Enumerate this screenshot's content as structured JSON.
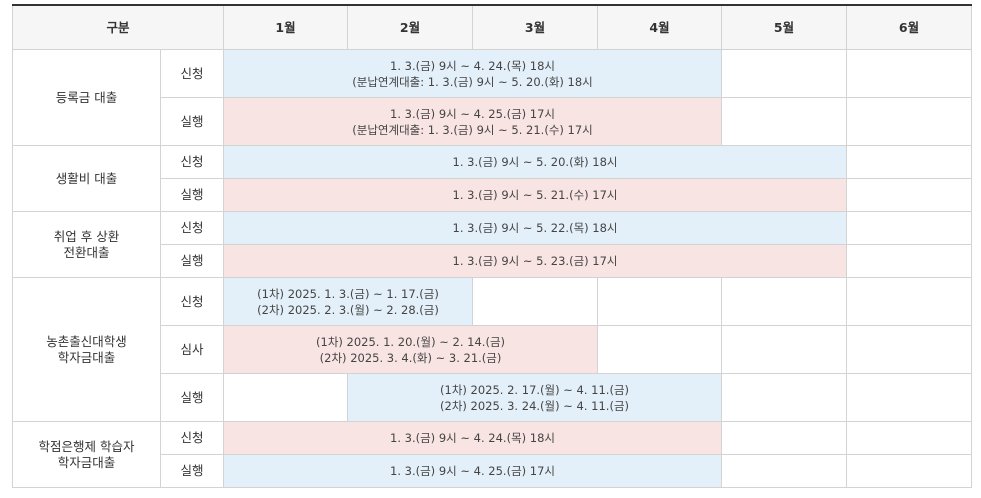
{
  "header": {
    "category": "구분",
    "months": [
      "1월",
      "2월",
      "3월",
      "4월",
      "5월",
      "6월"
    ]
  },
  "groups": [
    {
      "name": [
        "등록금 대출"
      ],
      "rows": [
        {
          "label": "신청",
          "lead": 0,
          "span": 4,
          "color": "blue",
          "lines": [
            "1. 3.(금) 9시 ~ 4. 24.(목) 18시",
            "(분납연계대출: 1. 3.(금) 9시 ~ 5. 20.(화) 18시"
          ]
        },
        {
          "label": "실행",
          "lead": 0,
          "span": 4,
          "color": "pink",
          "lines": [
            "1. 3.(금) 9시 ~ 4. 25.(금) 17시",
            "(분납연계대출: 1. 3.(금) 9시 ~ 5. 21.(수) 17시"
          ]
        }
      ]
    },
    {
      "name": [
        "생활비 대출"
      ],
      "rows": [
        {
          "label": "신청",
          "lead": 0,
          "span": 5,
          "color": "blue",
          "lines": [
            "1. 3.(금) 9시 ~ 5. 20.(화) 18시"
          ]
        },
        {
          "label": "실행",
          "lead": 0,
          "span": 5,
          "color": "pink",
          "lines": [
            "1. 3.(금) 9시 ~ 5. 21.(수) 17시"
          ]
        }
      ]
    },
    {
      "name": [
        "취업 후 상환",
        "전환대출"
      ],
      "rows": [
        {
          "label": "신청",
          "lead": 0,
          "span": 5,
          "color": "blue",
          "lines": [
            "1. 3.(금) 9시 ~ 5. 22.(목) 18시"
          ]
        },
        {
          "label": "실행",
          "lead": 0,
          "span": 5,
          "color": "pink",
          "lines": [
            "1. 3.(금) 9시 ~ 5. 23.(금) 17시"
          ]
        }
      ]
    },
    {
      "name": [
        "농촌출신대학생",
        "학자금대출"
      ],
      "rows": [
        {
          "label": "신청",
          "lead": 0,
          "span": 2,
          "color": "blue",
          "lines": [
            "(1차) 2025. 1. 3.(금) ~ 1. 17.(금)",
            "(2차) 2025. 2. 3.(월) ~ 2. 28.(금)"
          ]
        },
        {
          "label": "심사",
          "lead": 0,
          "span": 3,
          "color": "pink",
          "lines": [
            "(1차) 2025. 1. 20.(월) ~ 2. 14.(금)",
            "(2차) 2025. 3. 4.(화) ~ 3. 21.(금)"
          ]
        },
        {
          "label": "실행",
          "lead": 1,
          "span": 3,
          "color": "blue",
          "lines": [
            "(1차) 2025. 2. 17.(월) ~ 4. 11.(금)",
            "(2차) 2025. 3. 24.(월) ~ 4. 11.(금)"
          ]
        }
      ]
    },
    {
      "name": [
        "학점은행제 학습자",
        "학자금대출"
      ],
      "rows": [
        {
          "label": "신청",
          "lead": 0,
          "span": 4,
          "color": "pink",
          "lines": [
            "1. 3.(금) 9시 ~ 4. 24.(목) 18시"
          ]
        },
        {
          "label": "실행",
          "lead": 0,
          "span": 4,
          "color": "blue",
          "lines": [
            "1. 3.(금) 9시 ~ 4. 25.(금) 17시"
          ]
        }
      ]
    }
  ]
}
